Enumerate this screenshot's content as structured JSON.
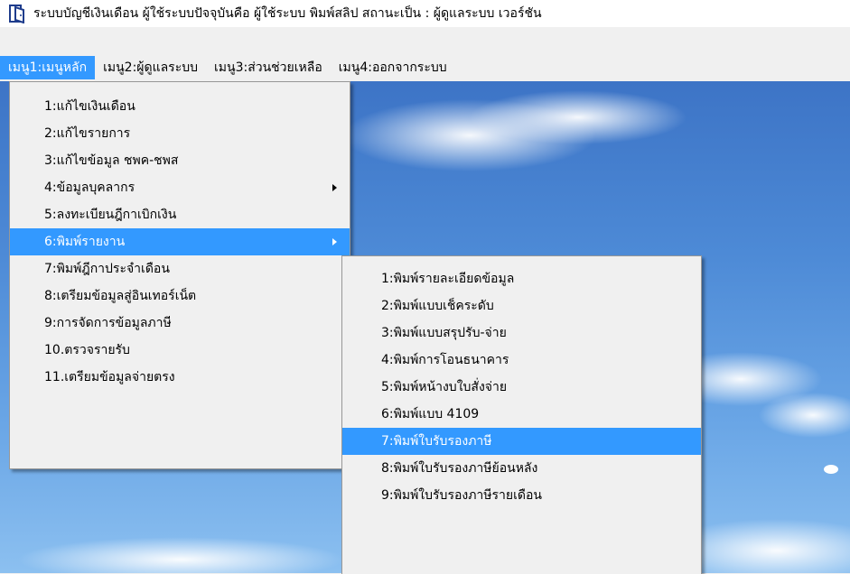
{
  "window": {
    "title": "ระบบบัญชีเงินเดือน ผู้ใช้ระบบปัจจุบันคือ ผู้ใช้ระบบ พิมพ์สลิป สถานะเป็น : ผู้ดูแลระบบ เวอร์ชัน",
    "icon": "app-door-icon"
  },
  "menubar": {
    "items": [
      {
        "label": "เมนู1:เมนูหลัก"
      },
      {
        "label": "เมนู2:ผู้ดูแลระบบ"
      },
      {
        "label": "เมนู3:ส่วนช่วยเหลือ"
      },
      {
        "label": "เมนู4:ออกจากระบบ"
      }
    ]
  },
  "main_menu": {
    "items": [
      {
        "label": "1:แก้ไขเงินเดือน"
      },
      {
        "label": "2:แก้ไขรายการ"
      },
      {
        "label": "3:แก้ไขข้อมูล ชพค-ชพส"
      },
      {
        "label": "4:ข้อมูลบุคลากร"
      },
      {
        "label": "5:ลงทะเบียนฎีกาเบิกเงิน"
      },
      {
        "label": "6:พิมพ์รายงาน"
      },
      {
        "label": "7:พิมพ์ฎีกาประจำเดือน"
      },
      {
        "label": "8:เตรียมข้อมูลสู่อินเทอร์เน็ต"
      },
      {
        "label": "9:การจัดการข้อมูลภาษี"
      },
      {
        "label": "10.ตรวจรายรับ"
      },
      {
        "label": "11.เตรียมข้อมูลจ่ายตรง"
      }
    ]
  },
  "report_submenu": {
    "items": [
      {
        "label": "1:พิมพ์รายละเอียดข้อมูล"
      },
      {
        "label": "2:พิมพ์แบบเช็คระดับ"
      },
      {
        "label": "3:พิมพ์แบบสรุปรับ-จ่าย"
      },
      {
        "label": "4:พิมพ์การโอนธนาคาร"
      },
      {
        "label": "5:พิมพ์หน้างบใบสั่งจ่าย"
      },
      {
        "label": "6:พิมพ์แบบ 4109"
      },
      {
        "label": "7:พิมพ์ใบรับรองภาษี"
      },
      {
        "label": "8:พิมพ์ใบรับรองภาษีย้อนหลัง"
      },
      {
        "label": "9:พิมพ์ใบรับรองภาษีรายเดือน"
      }
    ]
  },
  "colors": {
    "highlight": "#3399ff",
    "menu_background": "#f0f0f0",
    "sky": "#4d8ad6"
  }
}
